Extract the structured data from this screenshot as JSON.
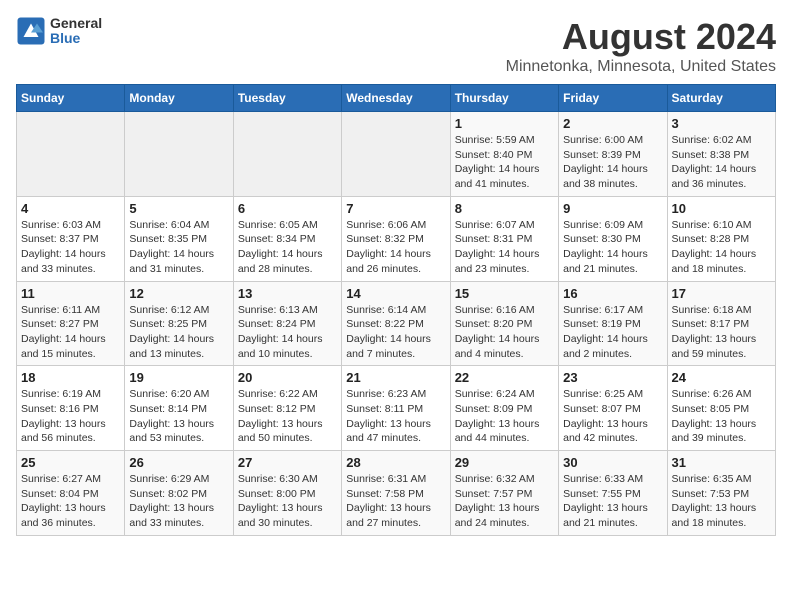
{
  "header": {
    "logo": {
      "general": "General",
      "blue": "Blue"
    },
    "title": "August 2024",
    "subtitle": "Minnetonka, Minnesota, United States"
  },
  "calendar": {
    "weekdays": [
      "Sunday",
      "Monday",
      "Tuesday",
      "Wednesday",
      "Thursday",
      "Friday",
      "Saturday"
    ],
    "weeks": [
      [
        {
          "day": "",
          "info": ""
        },
        {
          "day": "",
          "info": ""
        },
        {
          "day": "",
          "info": ""
        },
        {
          "day": "",
          "info": ""
        },
        {
          "day": "1",
          "info": "Sunrise: 5:59 AM\nSunset: 8:40 PM\nDaylight: 14 hours and 41 minutes."
        },
        {
          "day": "2",
          "info": "Sunrise: 6:00 AM\nSunset: 8:39 PM\nDaylight: 14 hours and 38 minutes."
        },
        {
          "day": "3",
          "info": "Sunrise: 6:02 AM\nSunset: 8:38 PM\nDaylight: 14 hours and 36 minutes."
        }
      ],
      [
        {
          "day": "4",
          "info": "Sunrise: 6:03 AM\nSunset: 8:37 PM\nDaylight: 14 hours and 33 minutes."
        },
        {
          "day": "5",
          "info": "Sunrise: 6:04 AM\nSunset: 8:35 PM\nDaylight: 14 hours and 31 minutes."
        },
        {
          "day": "6",
          "info": "Sunrise: 6:05 AM\nSunset: 8:34 PM\nDaylight: 14 hours and 28 minutes."
        },
        {
          "day": "7",
          "info": "Sunrise: 6:06 AM\nSunset: 8:32 PM\nDaylight: 14 hours and 26 minutes."
        },
        {
          "day": "8",
          "info": "Sunrise: 6:07 AM\nSunset: 8:31 PM\nDaylight: 14 hours and 23 minutes."
        },
        {
          "day": "9",
          "info": "Sunrise: 6:09 AM\nSunset: 8:30 PM\nDaylight: 14 hours and 21 minutes."
        },
        {
          "day": "10",
          "info": "Sunrise: 6:10 AM\nSunset: 8:28 PM\nDaylight: 14 hours and 18 minutes."
        }
      ],
      [
        {
          "day": "11",
          "info": "Sunrise: 6:11 AM\nSunset: 8:27 PM\nDaylight: 14 hours and 15 minutes."
        },
        {
          "day": "12",
          "info": "Sunrise: 6:12 AM\nSunset: 8:25 PM\nDaylight: 14 hours and 13 minutes."
        },
        {
          "day": "13",
          "info": "Sunrise: 6:13 AM\nSunset: 8:24 PM\nDaylight: 14 hours and 10 minutes."
        },
        {
          "day": "14",
          "info": "Sunrise: 6:14 AM\nSunset: 8:22 PM\nDaylight: 14 hours and 7 minutes."
        },
        {
          "day": "15",
          "info": "Sunrise: 6:16 AM\nSunset: 8:20 PM\nDaylight: 14 hours and 4 minutes."
        },
        {
          "day": "16",
          "info": "Sunrise: 6:17 AM\nSunset: 8:19 PM\nDaylight: 14 hours and 2 minutes."
        },
        {
          "day": "17",
          "info": "Sunrise: 6:18 AM\nSunset: 8:17 PM\nDaylight: 13 hours and 59 minutes."
        }
      ],
      [
        {
          "day": "18",
          "info": "Sunrise: 6:19 AM\nSunset: 8:16 PM\nDaylight: 13 hours and 56 minutes."
        },
        {
          "day": "19",
          "info": "Sunrise: 6:20 AM\nSunset: 8:14 PM\nDaylight: 13 hours and 53 minutes."
        },
        {
          "day": "20",
          "info": "Sunrise: 6:22 AM\nSunset: 8:12 PM\nDaylight: 13 hours and 50 minutes."
        },
        {
          "day": "21",
          "info": "Sunrise: 6:23 AM\nSunset: 8:11 PM\nDaylight: 13 hours and 47 minutes."
        },
        {
          "day": "22",
          "info": "Sunrise: 6:24 AM\nSunset: 8:09 PM\nDaylight: 13 hours and 44 minutes."
        },
        {
          "day": "23",
          "info": "Sunrise: 6:25 AM\nSunset: 8:07 PM\nDaylight: 13 hours and 42 minutes."
        },
        {
          "day": "24",
          "info": "Sunrise: 6:26 AM\nSunset: 8:05 PM\nDaylight: 13 hours and 39 minutes."
        }
      ],
      [
        {
          "day": "25",
          "info": "Sunrise: 6:27 AM\nSunset: 8:04 PM\nDaylight: 13 hours and 36 minutes."
        },
        {
          "day": "26",
          "info": "Sunrise: 6:29 AM\nSunset: 8:02 PM\nDaylight: 13 hours and 33 minutes."
        },
        {
          "day": "27",
          "info": "Sunrise: 6:30 AM\nSunset: 8:00 PM\nDaylight: 13 hours and 30 minutes."
        },
        {
          "day": "28",
          "info": "Sunrise: 6:31 AM\nSunset: 7:58 PM\nDaylight: 13 hours and 27 minutes."
        },
        {
          "day": "29",
          "info": "Sunrise: 6:32 AM\nSunset: 7:57 PM\nDaylight: 13 hours and 24 minutes."
        },
        {
          "day": "30",
          "info": "Sunrise: 6:33 AM\nSunset: 7:55 PM\nDaylight: 13 hours and 21 minutes."
        },
        {
          "day": "31",
          "info": "Sunrise: 6:35 AM\nSunset: 7:53 PM\nDaylight: 13 hours and 18 minutes."
        }
      ]
    ]
  }
}
